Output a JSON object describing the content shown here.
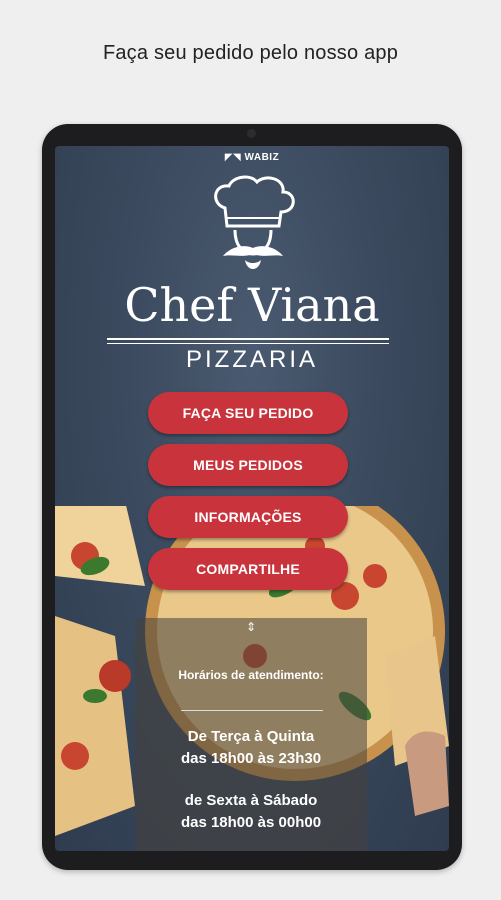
{
  "caption": "Faça seu pedido pelo nosso app",
  "brand": "WABIZ",
  "title": "Chef Viana",
  "subtitle": "PIZZARIA",
  "buttons": {
    "order": "FAÇA SEU PEDIDO",
    "my_orders": "MEUS PEDIDOS",
    "info": "INFORMAÇÕES",
    "share": "COMPARTILHE"
  },
  "hours": {
    "toggle_icon": "⇕",
    "title": "Horários de atendimento:",
    "line1": "De Terça à Quinta",
    "line2": "das 18h00 às 23h30",
    "line3": "de Sexta à Sábado",
    "line4": "das 18h00 às 00h00"
  },
  "colors": {
    "accent": "#c9343c",
    "background": "#3b4a5e"
  }
}
